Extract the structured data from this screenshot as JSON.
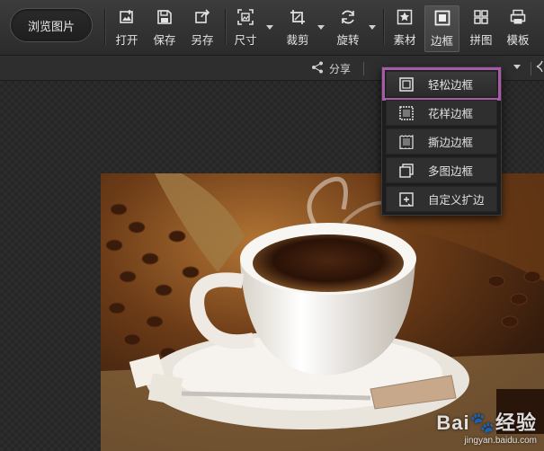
{
  "toolbar": {
    "browse_label": "浏览图片",
    "tools": [
      {
        "id": "open",
        "label": "打开",
        "icon": "open-image-icon"
      },
      {
        "id": "save",
        "label": "保存",
        "icon": "save-icon"
      },
      {
        "id": "save_as",
        "label": "另存",
        "icon": "save-as-icon"
      },
      {
        "id": "size",
        "label": "尺寸",
        "icon": "resize-icon"
      },
      {
        "id": "crop",
        "label": "裁剪",
        "icon": "crop-icon"
      },
      {
        "id": "rotate",
        "label": "旋转",
        "icon": "rotate-icon"
      },
      {
        "id": "material",
        "label": "素材",
        "icon": "star-frame-icon"
      },
      {
        "id": "border",
        "label": "边框",
        "icon": "border-icon"
      },
      {
        "id": "collage",
        "label": "拼图",
        "icon": "grid-icon"
      },
      {
        "id": "template",
        "label": "模板",
        "icon": "printer-icon"
      }
    ],
    "active_tool": "边框"
  },
  "subbar": {
    "share_label": "分享"
  },
  "border_menu": {
    "items": [
      {
        "label": "轻松边框",
        "icon": "simple-border-icon",
        "selected": true
      },
      {
        "label": "花样边框",
        "icon": "pattern-border-icon",
        "selected": false
      },
      {
        "label": "撕边边框",
        "icon": "torn-border-icon",
        "selected": false
      },
      {
        "label": "多图边框",
        "icon": "multi-image-border-icon",
        "selected": false
      },
      {
        "label": "自定义扩边",
        "icon": "custom-extend-icon",
        "selected": false
      }
    ]
  },
  "photo": {
    "subject": "coffee-cup-photo"
  },
  "watermark": {
    "brand": "Bai",
    "brand_suffix": "经验",
    "url": "jingyan.baidu.com"
  },
  "colors": {
    "highlight": "#a65aa8",
    "toolbar_bg": "#333333"
  }
}
